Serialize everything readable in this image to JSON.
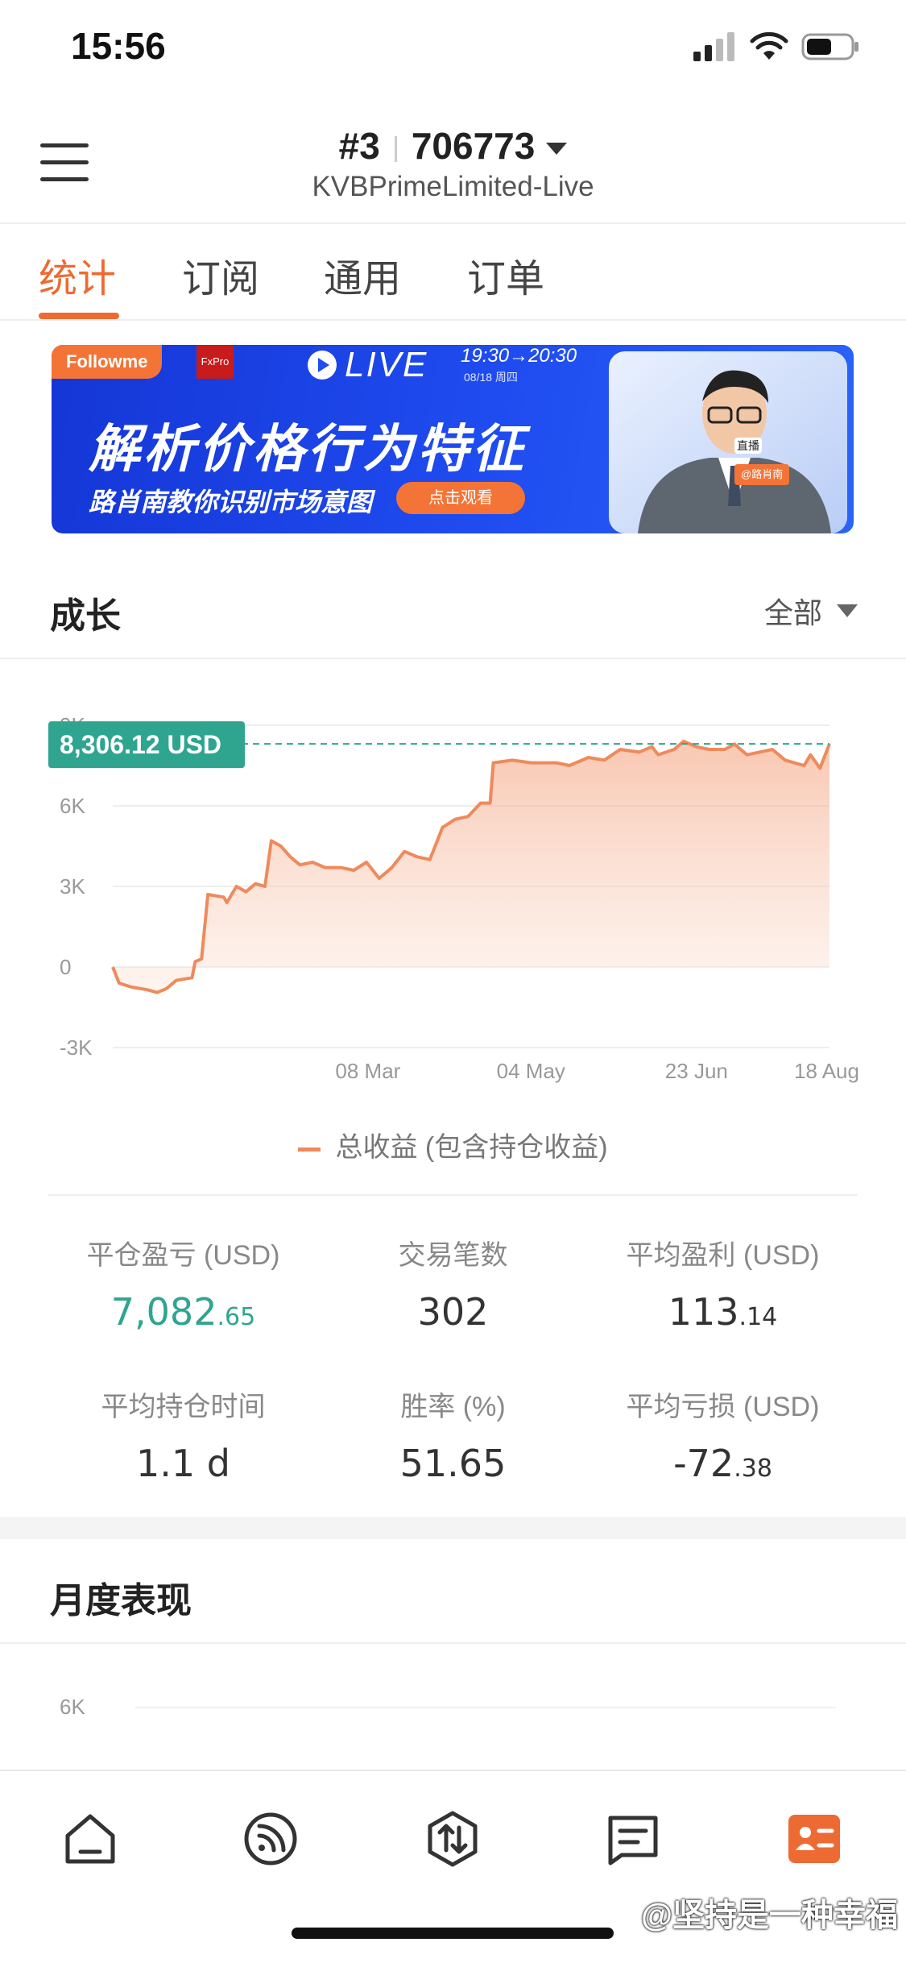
{
  "status_bar": {
    "time": "15:56"
  },
  "header": {
    "account_rank": "#3",
    "account_id": "706773",
    "server": "KVBPrimeLimited-Live"
  },
  "tabs": [
    {
      "label": "统计",
      "active": true
    },
    {
      "label": "订阅",
      "active": false
    },
    {
      "label": "通用",
      "active": false
    },
    {
      "label": "订单",
      "active": false
    }
  ],
  "banner": {
    "brand": "Followme",
    "partner": "FxPro",
    "live": "LIVE",
    "time": "19:30→20:30",
    "date": "08/18 周四",
    "title": "解析价格行为特征",
    "subtitle": "路肖南教你识别市场意图",
    "button": "点击观看",
    "badge": "直播",
    "host": "@路肖南"
  },
  "growth": {
    "title": "成长",
    "filter": "全部"
  },
  "chart_data": {
    "type": "area",
    "y_ticks": [
      "9K",
      "6K",
      "3K",
      "0",
      "-3K"
    ],
    "x_ticks": [
      "08 Mar",
      "04 May",
      "23 Jun",
      "18 Aug"
    ],
    "ylim": [
      -3000,
      9000
    ],
    "current_label": "8,306.12 USD",
    "current_value": 8306.12,
    "series": [
      {
        "name": "总收益 (包含持仓收益)",
        "color": "#ee8a5c",
        "points": [
          [
            0,
            0
          ],
          [
            0.01,
            -600
          ],
          [
            0.03,
            -750
          ],
          [
            0.055,
            -850
          ],
          [
            0.07,
            -950
          ],
          [
            0.085,
            -800
          ],
          [
            0.1,
            -500
          ],
          [
            0.125,
            -400
          ],
          [
            0.13,
            200
          ],
          [
            0.14,
            300
          ],
          [
            0.15,
            2700
          ],
          [
            0.175,
            2600
          ],
          [
            0.18,
            2400
          ],
          [
            0.195,
            3000
          ],
          [
            0.21,
            2800
          ],
          [
            0.225,
            3100
          ],
          [
            0.24,
            3000
          ],
          [
            0.25,
            4700
          ],
          [
            0.265,
            4500
          ],
          [
            0.28,
            4100
          ],
          [
            0.295,
            3800
          ],
          [
            0.315,
            3900
          ],
          [
            0.335,
            3700
          ],
          [
            0.36,
            3700
          ],
          [
            0.38,
            3600
          ],
          [
            0.4,
            3900
          ],
          [
            0.42,
            3300
          ],
          [
            0.44,
            3700
          ],
          [
            0.46,
            4300
          ],
          [
            0.48,
            4100
          ],
          [
            0.5,
            4000
          ],
          [
            0.52,
            5200
          ],
          [
            0.54,
            5500
          ],
          [
            0.56,
            5600
          ],
          [
            0.58,
            6100
          ],
          [
            0.595,
            6100
          ],
          [
            0.6,
            7600
          ],
          [
            0.63,
            7700
          ],
          [
            0.66,
            7600
          ],
          [
            0.7,
            7600
          ],
          [
            0.72,
            7500
          ],
          [
            0.75,
            7800
          ],
          [
            0.775,
            7700
          ],
          [
            0.8,
            8100
          ],
          [
            0.83,
            8000
          ],
          [
            0.85,
            8200
          ],
          [
            0.86,
            7900
          ],
          [
            0.885,
            8100
          ],
          [
            0.9,
            8400
          ],
          [
            0.92,
            8200
          ],
          [
            0.94,
            8100
          ],
          [
            0.965,
            8100
          ],
          [
            0.98,
            8300
          ],
          [
            1.0,
            7900
          ],
          [
            1.02,
            8000
          ],
          [
            1.04,
            8100
          ],
          [
            1.06,
            7700
          ],
          [
            1.075,
            7600
          ],
          [
            1.09,
            7500
          ],
          [
            1.1,
            7900
          ],
          [
            1.115,
            7400
          ],
          [
            1.13,
            8306.12
          ]
        ]
      }
    ]
  },
  "stats": [
    {
      "label": "平仓盈亏 (USD)",
      "int": "7,082",
      "dec": ".65",
      "green": true
    },
    {
      "label": "交易笔数",
      "int": "302",
      "dec": "",
      "green": false
    },
    {
      "label": "平均盈利 (USD)",
      "int": "113",
      "dec": ".14",
      "green": false
    },
    {
      "label": "平均持仓时间",
      "int": "1.1 d",
      "dec": "",
      "green": false
    },
    {
      "label": "胜率 (%)",
      "int": "51.65",
      "dec": "",
      "green": false
    },
    {
      "label": "平均亏损 (USD)",
      "int": "-72",
      "dec": ".38",
      "green": false
    }
  ],
  "monthly": {
    "title": "月度表现",
    "y_tick": "6K"
  },
  "watermark": "@坚持是一种幸福",
  "colors": {
    "accent": "#ee6a33",
    "positive": "#2fa590",
    "series": "#ee8a5c"
  }
}
